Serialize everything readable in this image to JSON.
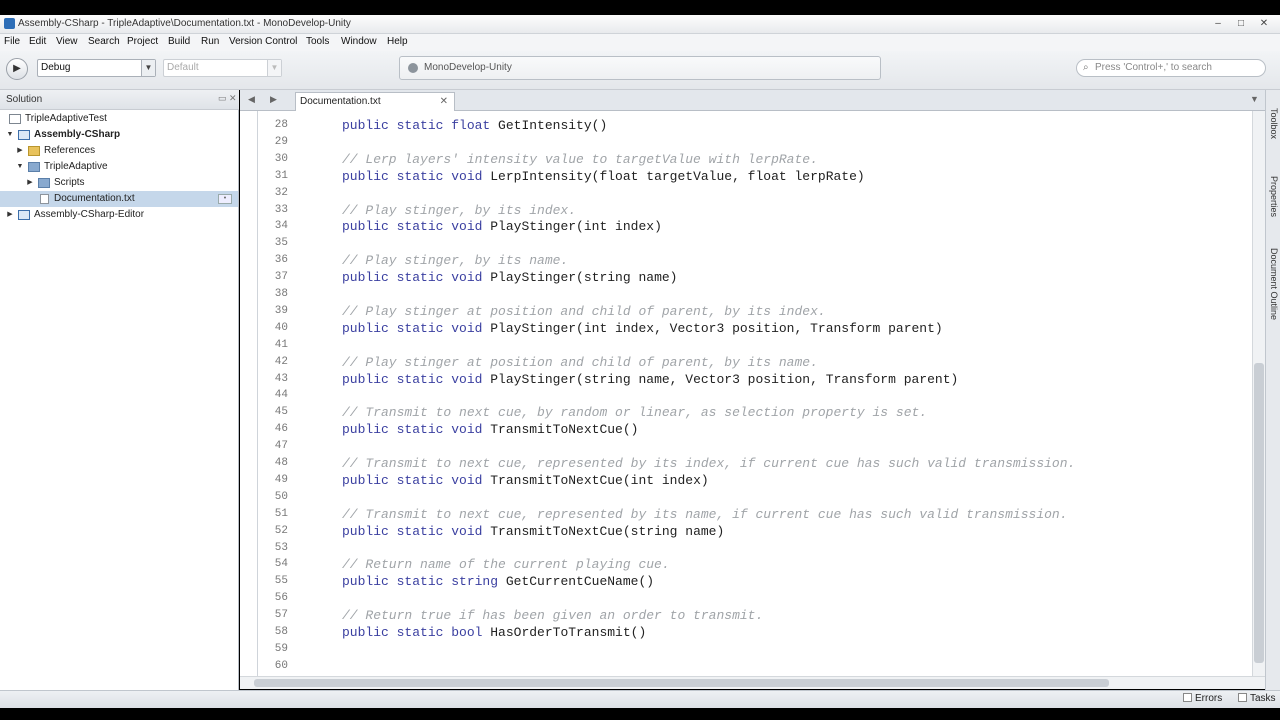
{
  "window": {
    "title": "Assembly-CSharp - TripleAdaptive\\Documentation.txt - MonoDevelop-Unity",
    "minimize": "–",
    "maximize": "□",
    "close": "✕"
  },
  "menu": [
    "File",
    "Edit",
    "View",
    "Search",
    "Project",
    "Build",
    "Run",
    "Version Control",
    "Tools",
    "Window",
    "Help"
  ],
  "toolbar": {
    "run_icon": "▶",
    "configuration": "Debug",
    "platform": "Default",
    "status": "MonoDevelop-Unity",
    "search_placeholder": "Press 'Control+,' to search",
    "search_icon": "⌕"
  },
  "solution": {
    "header": "Solution",
    "header_buttons": "▭ ✕",
    "items": [
      {
        "label": "TripleAdaptiveTest",
        "expander": "",
        "icon": "solution-icon",
        "bold": false,
        "selected": false
      },
      {
        "label": "Assembly-CSharp",
        "expander": "▼",
        "icon": "project-icon",
        "bold": true,
        "selected": false
      },
      {
        "label": "References",
        "expander": "▶",
        "icon": "folder-icon",
        "bold": false,
        "selected": false
      },
      {
        "label": "TripleAdaptive",
        "expander": "▼",
        "icon": "folder-icon",
        "bold": false,
        "selected": false
      },
      {
        "label": "Scripts",
        "expander": "▶",
        "icon": "folder-icon",
        "bold": false,
        "selected": false
      },
      {
        "label": "Documentation.txt",
        "expander": "",
        "icon": "file-icon",
        "bold": false,
        "selected": true
      },
      {
        "label": "Assembly-CSharp-Editor",
        "expander": "▶",
        "icon": "project-icon",
        "bold": false,
        "selected": false
      }
    ]
  },
  "editor": {
    "tab_label": "Documentation.txt",
    "tab_close": "✕",
    "nav_back": "◀",
    "nav_forward": "▶",
    "nav_menu": "▼",
    "lines": [
      {
        "n": "28",
        "text": "public static float GetIntensity()",
        "type": "code"
      },
      {
        "n": "29",
        "text": "",
        "type": "code"
      },
      {
        "n": "30",
        "text": "// Lerp layers' intensity value to targetValue with lerpRate.",
        "type": "comment"
      },
      {
        "n": "31",
        "text": "public static void LerpIntensity(float targetValue, float lerpRate)",
        "type": "code"
      },
      {
        "n": "32",
        "text": "",
        "type": "code"
      },
      {
        "n": "33",
        "text": "// Play stinger, by its index.",
        "type": "comment"
      },
      {
        "n": "34",
        "text": "public static void PlayStinger(int index)",
        "type": "code"
      },
      {
        "n": "35",
        "text": "",
        "type": "code"
      },
      {
        "n": "36",
        "text": "// Play stinger, by its name.",
        "type": "comment"
      },
      {
        "n": "37",
        "text": "public static void PlayStinger(string name)",
        "type": "code"
      },
      {
        "n": "38",
        "text": "",
        "type": "code"
      },
      {
        "n": "39",
        "text": "// Play stinger at position and child of parent, by its index.",
        "type": "comment"
      },
      {
        "n": "40",
        "text": "public static void PlayStinger(int index, Vector3 position, Transform parent)",
        "type": "code"
      },
      {
        "n": "41",
        "text": "",
        "type": "code"
      },
      {
        "n": "42",
        "text": "// Play stinger at position and child of parent, by its name.",
        "type": "comment"
      },
      {
        "n": "43",
        "text": "public static void PlayStinger(string name, Vector3 position, Transform parent)",
        "type": "code"
      },
      {
        "n": "44",
        "text": "",
        "type": "code"
      },
      {
        "n": "45",
        "text": "// Transmit to next cue, by random or linear, as selection property is set.",
        "type": "comment"
      },
      {
        "n": "46",
        "text": "public static void TransmitToNextCue()",
        "type": "code"
      },
      {
        "n": "47",
        "text": "",
        "type": "code"
      },
      {
        "n": "48",
        "text": "// Transmit to next cue, represented by its index, if current cue has such valid transmission.",
        "type": "comment"
      },
      {
        "n": "49",
        "text": "public static void TransmitToNextCue(int index)",
        "type": "code"
      },
      {
        "n": "50",
        "text": "",
        "type": "code"
      },
      {
        "n": "51",
        "text": "// Transmit to next cue, represented by its name, if current cue has such valid transmission.",
        "type": "comment"
      },
      {
        "n": "52",
        "text": "public static void TransmitToNextCue(string name)",
        "type": "code"
      },
      {
        "n": "53",
        "text": "",
        "type": "code"
      },
      {
        "n": "54",
        "text": "// Return name of the current playing cue.",
        "type": "comment"
      },
      {
        "n": "55",
        "text": "public static string GetCurrentCueName()",
        "type": "code"
      },
      {
        "n": "56",
        "text": "",
        "type": "code"
      },
      {
        "n": "57",
        "text": "// Return true if has been given an order to transmit.",
        "type": "comment"
      },
      {
        "n": "58",
        "text": "public static bool HasOrderToTransmit()",
        "type": "code"
      },
      {
        "n": "59",
        "text": "",
        "type": "code"
      },
      {
        "n": "60",
        "text": "",
        "type": "code"
      }
    ]
  },
  "right_dock": [
    "Toolbox",
    "Properties",
    "Document Outline"
  ],
  "statusbar": {
    "errors": "Errors",
    "tasks": "Tasks"
  }
}
